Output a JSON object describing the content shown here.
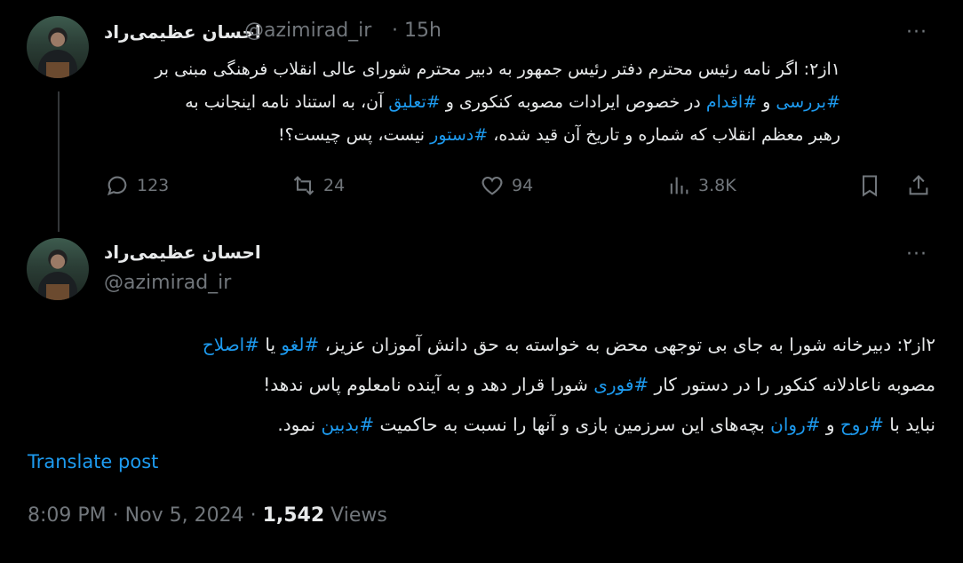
{
  "tweet1": {
    "name": "احسان عظیمی‌راد",
    "handle": "@azimirad_ir",
    "time": "· 15h",
    "more": "···",
    "line1": "۱از۲: اگر نامه رئیس محترم دفتر رئیس جمهور به دبیر محترم شورای عالی انقلاب فرهنگی مبنی بر",
    "line2": [
      {
        "t": "#بررسی",
        "h": true
      },
      {
        "t": " و ",
        "h": false
      },
      {
        "t": "#اقدام",
        "h": true
      },
      {
        "t": " در خصوص ایرادات مصوبه کنکوری و ",
        "h": false
      },
      {
        "t": "#تعلیق",
        "h": true
      },
      {
        "t": " آن، به استناد نامه اینجانب به",
        "h": false
      }
    ],
    "line3": [
      {
        "t": "رهبر معظم انقلاب که شماره و تاریخ آن قید شده، ",
        "h": false
      },
      {
        "t": "#دستور",
        "h": true
      },
      {
        "t": " نیست، پس چیست؟!",
        "h": false
      }
    ],
    "actions": {
      "replies": "123",
      "retweets": "24",
      "likes": "94",
      "views": "3.8K"
    }
  },
  "tweet2": {
    "name": "احسان عظیمی‌راد",
    "handle": "@azimirad_ir",
    "more": "···",
    "line1": [
      {
        "t": "۲از۲: دبیرخانه شورا به جای بی توجهی محض به خواسته به حق دانش آموزان عزیز، ",
        "h": false
      },
      {
        "t": "#لغو",
        "h": true
      },
      {
        "t": " یا ",
        "h": false
      },
      {
        "t": "#اصلاح",
        "h": true
      }
    ],
    "line2": [
      {
        "t": "مصوبه ناعادلانه کنکور را در دستور کار ",
        "h": false
      },
      {
        "t": "#فوری",
        "h": true
      },
      {
        "t": " شورا قرار دهد و به آینده نامعلوم پاس ندهد!",
        "h": false
      }
    ],
    "line3": [
      {
        "t": "نباید با ",
        "h": false
      },
      {
        "t": "#روح",
        "h": true
      },
      {
        "t": " و ",
        "h": false
      },
      {
        "t": "#روان",
        "h": true
      },
      {
        "t": " بچه‌های این سرزمین بازی و آنها را نسبت به حاکمیت ",
        "h": false
      },
      {
        "t": "#بدبین",
        "h": true
      },
      {
        "t": " نمود.",
        "h": false
      }
    ],
    "translate": "Translate post",
    "time": "8:09 PM",
    "date": "Nov 5, 2024",
    "views_count": "1,542",
    "views_label": "Views"
  },
  "colors": {
    "accent": "#1d9bf0",
    "muted": "#71767b",
    "text": "#e7e9ea",
    "background": "#000000"
  },
  "icons": [
    "reply-icon",
    "retweet-icon",
    "like-icon",
    "views-icon",
    "bookmark-icon",
    "share-icon",
    "more-icon"
  ]
}
